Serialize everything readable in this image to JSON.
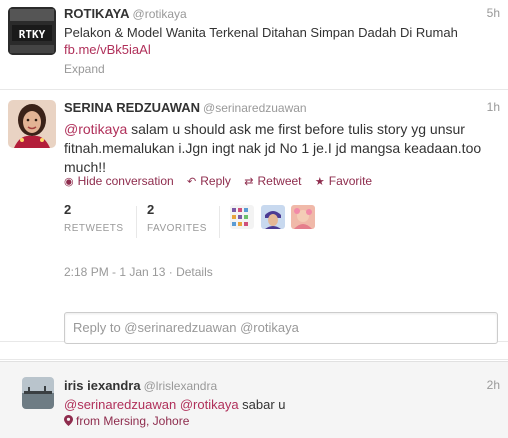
{
  "tweets": [
    {
      "fullname": "ROTIKAYA",
      "username": "@rotikaya",
      "time": "5h",
      "avatar_text": "RTKY",
      "text": "Pelakon & Model Wanita Terkenal Ditahan Simpan Dadah Di Rumah",
      "link": "fb.me/vBk5iaAl",
      "expand": "Expand"
    },
    {
      "fullname": "SERINA REDZUAWAN",
      "username": "@serinaredzuawan",
      "time": "1h",
      "mention": "@rotikaya",
      "text_line1": " salam u should ask me first before tulis story yg unsur",
      "text_line2": "fitnah.memalukan i.Jgn ingt nak jd No 1 je.I jd mangsa keadaan.too",
      "text_line3": "much!!",
      "actions": {
        "hide": "Hide conversation",
        "reply": "Reply",
        "retweet": "Retweet",
        "favorite": "Favorite"
      },
      "stats": {
        "retweets_count": "2",
        "retweets_label": "RETWEETS",
        "favorites_count": "2",
        "favorites_label": "FAVORITES"
      },
      "datetime": "2:18 PM - 1 Jan 13",
      "separator": " · ",
      "details": "Details",
      "reply_placeholder": "Reply to @serinaredzuawan @rotikaya"
    },
    {
      "fullname": "iris iexandra",
      "username": "@lrislexandra",
      "time": "2h",
      "mention1": "@serinaredzuawan",
      "mention2": "@rotikaya",
      "text": " sabar u",
      "geo": "from Mersing, Johore"
    }
  ],
  "colors": {
    "link": "#b0305a",
    "action": "#8e2c4d",
    "muted": "#999999"
  },
  "icons": [
    "comment-icon",
    "reply-icon",
    "retweet-icon",
    "star-icon",
    "location-pin-icon"
  ]
}
